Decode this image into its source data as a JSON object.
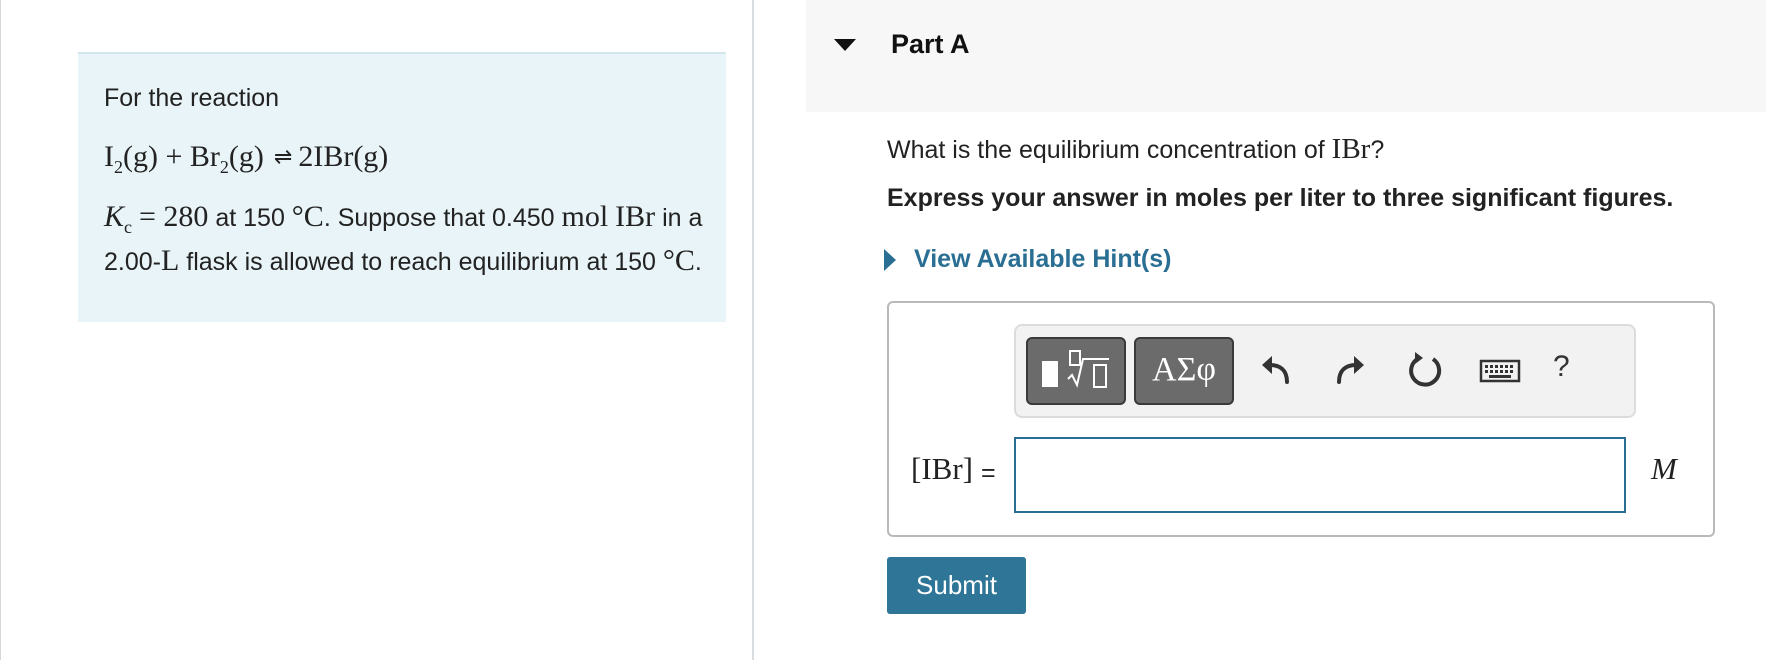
{
  "problem": {
    "intro": "For the reaction",
    "equation": {
      "r1": "I",
      "r1_sub": "2",
      "r1_phase": "(g)",
      "plus": "+",
      "r2": "Br",
      "r2_sub": "2",
      "r2_phase": "(g)",
      "arrows": "⇌",
      "product": "2IBr(g)"
    },
    "kc_symbol": "K",
    "kc_sub": "c",
    "kc_eq": "= 280",
    "t1": " at 150 ",
    "deg1": "°C",
    "t2": ". Suppose that 0.450 ",
    "mol": "mol",
    "ibr": "IBr",
    "t3": " in a 2.00-",
    "liter": "L",
    "t4": " flask is allowed to reach equilibrium at 150 ",
    "deg2": "°C",
    "t5": "."
  },
  "part": {
    "title": "Part A"
  },
  "question": {
    "prefix": "What is the equilibrium concentration of ",
    "species": "IBr",
    "suffix": "?"
  },
  "instruction": "Express your answer in moles per liter to three significant figures.",
  "hint": {
    "label": "View Available Hint(s)"
  },
  "toolbar": {
    "templates_icon": "templates-icon",
    "symbols_label": "ΑΣφ",
    "undo_icon": "undo-icon",
    "redo_icon": "redo-icon",
    "reset_icon": "reset-icon",
    "keyboard_icon": "keyboard-icon",
    "help_label": "?"
  },
  "answer": {
    "label": "[IBr]",
    "equals": "=",
    "value": "",
    "unit": "M"
  },
  "submit": {
    "label": "Submit"
  },
  "colors": {
    "accent": "#2a6f93",
    "panel_bg": "#e8f4f7",
    "header_bg": "#f7f7f7",
    "submit_bg": "#2f7597"
  }
}
